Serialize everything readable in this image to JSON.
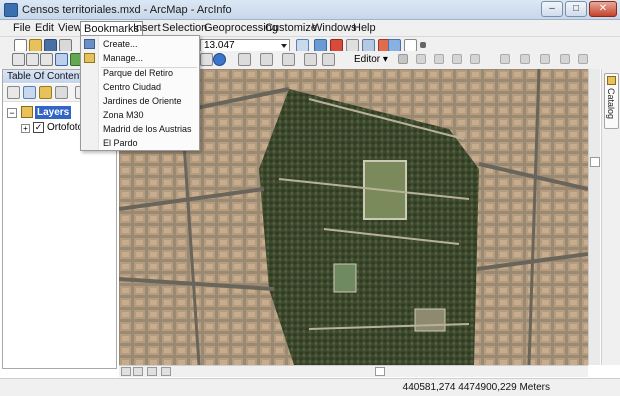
{
  "window": {
    "title": "Censos territoriales.mxd - ArcMap - ArcInfo",
    "controls": [
      "–",
      "□",
      "✕"
    ]
  },
  "menubar": {
    "items": [
      "File",
      "Edit",
      "View",
      "Bookmarks",
      "Insert",
      "Selection",
      "Geoprocessing",
      "Customize",
      "Windows",
      "Help"
    ],
    "active": "Bookmarks"
  },
  "toolbar": {
    "scale_value": "13.047",
    "editor_label": "Editor ▾"
  },
  "toc": {
    "header": "Table Of Contents",
    "layers_label": "Layers",
    "layer_item": "Ortofotos"
  },
  "bookmarks_menu": {
    "create": "Create...",
    "manage": "Manage...",
    "bookmarks": [
      "Parque del Retiro",
      "Centro Ciudad",
      "Jardines de Oriente",
      "Zona M30",
      "Madrid de los Austrias",
      "El Pardo"
    ]
  },
  "catalog": {
    "label": "Catalog"
  },
  "status": {
    "coordinates": "440581,274  4474900,229 Meters"
  },
  "colors": {
    "accent": "#3b6fb0",
    "park": "#3e4a2e",
    "city": "#9a8a73"
  }
}
